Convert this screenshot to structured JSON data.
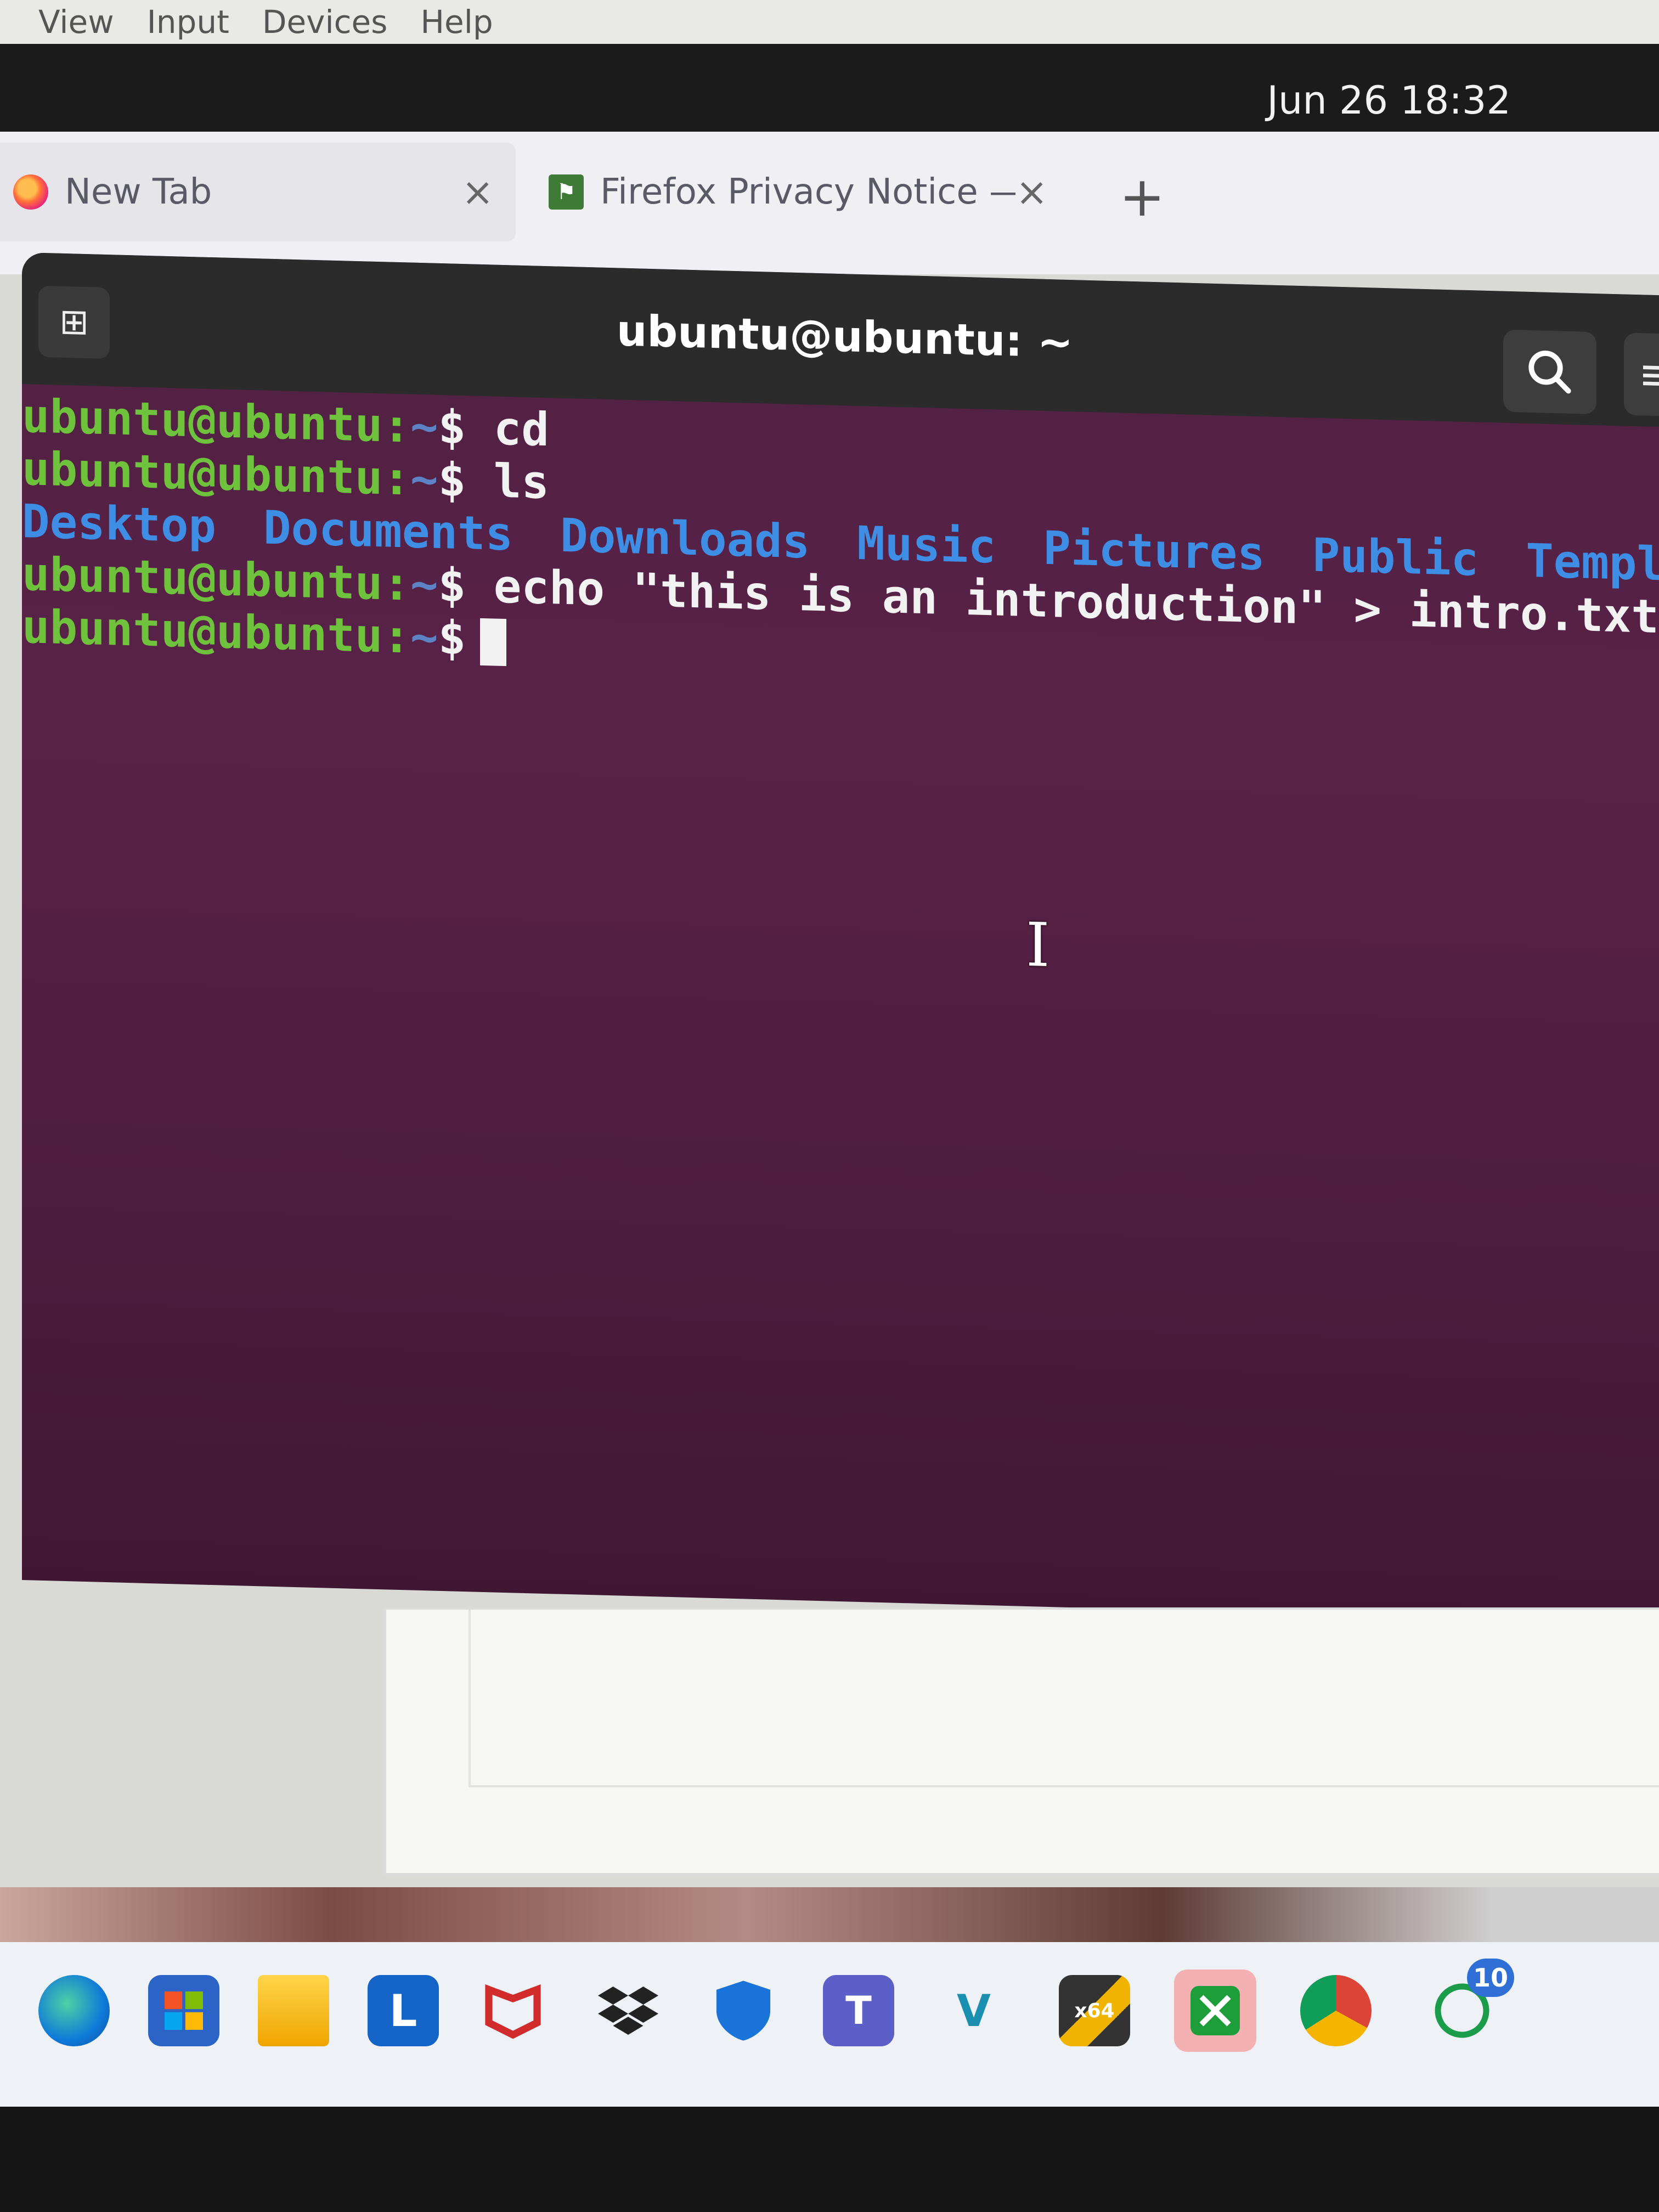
{
  "vm_menu": {
    "items": [
      "View",
      "Input",
      "Devices",
      "Help"
    ]
  },
  "ubuntu_topbar": {
    "clock": "Jun 26  18:32"
  },
  "browser": {
    "tabs": [
      {
        "label": "New Tab",
        "close": "×",
        "favicon": "firefox-icon"
      },
      {
        "label": "Firefox Privacy Notice — ",
        "close": "×",
        "favicon": "document-icon"
      }
    ],
    "new_tab": "+"
  },
  "terminal": {
    "title": "ubuntu@ubuntu: ~",
    "prompt_user": "ubuntu@ubuntu:",
    "prompt_path": "~",
    "prompt_symbol": "$",
    "commands": [
      "cd",
      "ls",
      "echo \"this is an introduction\" > intro.txt"
    ],
    "ls_output": [
      "Desktop",
      "Documents",
      "Downloads",
      "Music",
      "Pictures",
      "Public",
      "Templates"
    ],
    "colors": {
      "background": "#5a2148",
      "prompt_user": "#6fc33c",
      "prompt_path": "#5d82c6",
      "directory": "#3e8ee6",
      "text": "#f2f2f2"
    }
  },
  "host_taskbar": {
    "icons": [
      {
        "name": "edge-icon"
      },
      {
        "name": "store-icon"
      },
      {
        "name": "file-explorer-icon"
      },
      {
        "name": "l-app-icon",
        "glyph": "L"
      },
      {
        "name": "mcafee-icon"
      },
      {
        "name": "dropbox-icon"
      },
      {
        "name": "defender-icon"
      },
      {
        "name": "teams-icon"
      },
      {
        "name": "visual-studio-icon"
      },
      {
        "name": "x64-app-icon",
        "glyph": "x64"
      },
      {
        "name": "xbox-icon"
      },
      {
        "name": "chrome-icon"
      },
      {
        "name": "whatsapp-icon",
        "badge": "10"
      }
    ]
  }
}
